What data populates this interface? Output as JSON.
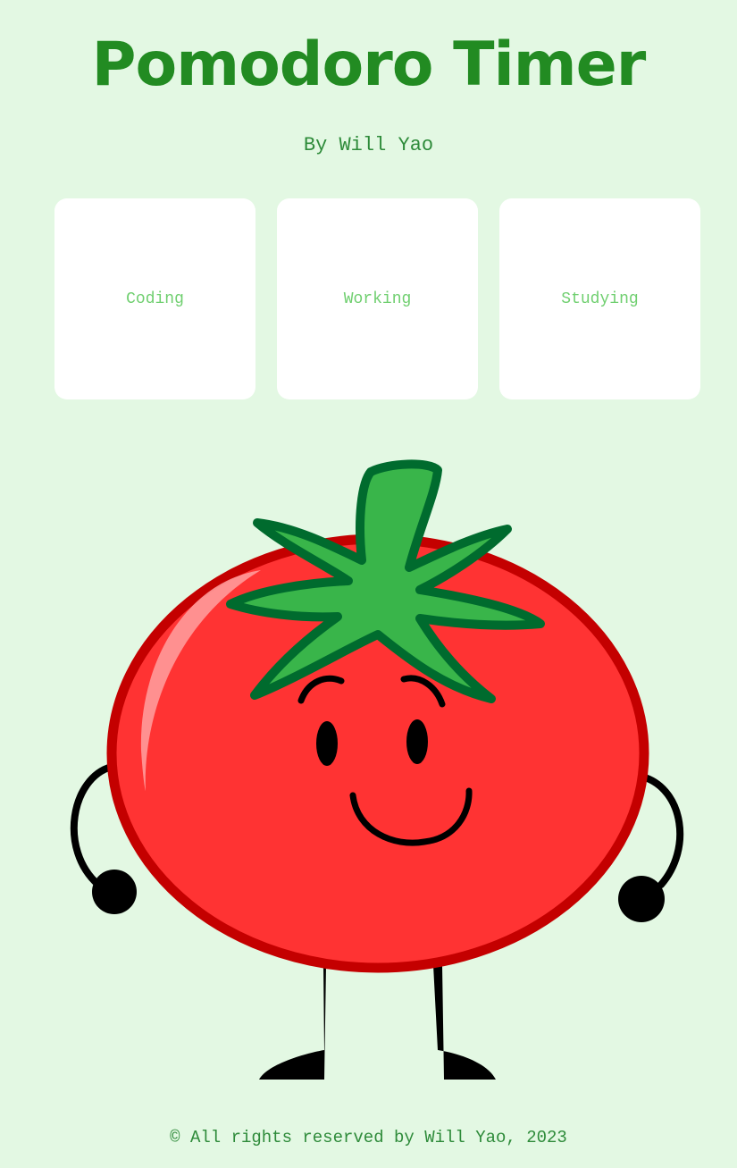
{
  "header": {
    "title": "Pomodoro Timer",
    "byline": "By Will Yao"
  },
  "modes": [
    {
      "label": "Coding"
    },
    {
      "label": "Working"
    },
    {
      "label": "Studying"
    }
  ],
  "mascot": {
    "icon": "tomato-mascot-icon"
  },
  "footer": {
    "text": "© All rights reserved by Will Yao, 2023"
  },
  "colors": {
    "background": "#e3f8e3",
    "title": "#228b22",
    "card_bg": "#ffffff",
    "card_text": "#6fcf6f",
    "tomato_red": "#ff3333",
    "tomato_outline": "#c40000",
    "leaf_green": "#39b54a",
    "leaf_outline": "#006b2e"
  }
}
